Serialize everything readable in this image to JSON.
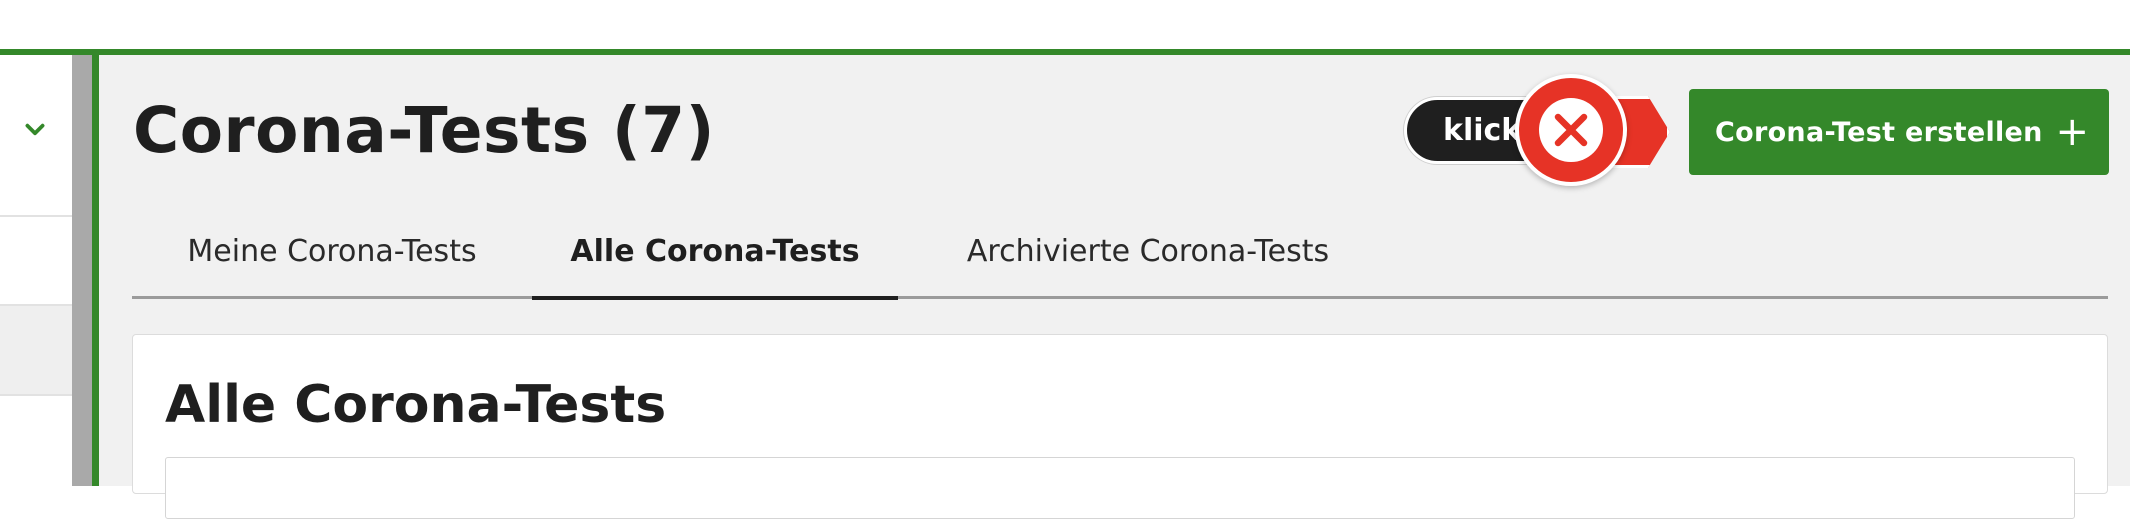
{
  "page": {
    "title": "Corona-Tests (7)"
  },
  "tutorial_hint": {
    "label": "klick",
    "close_icon": "close-x-icon",
    "color": "#e63326"
  },
  "actions": {
    "create_label": "Corona-Test erstellen",
    "create_icon": "plus-icon"
  },
  "tabs": [
    {
      "label": "Meine Corona-Tests",
      "active": false
    },
    {
      "label": "Alle Corona-Tests",
      "active": true
    },
    {
      "label": "Archivierte Corona-Tests",
      "active": false
    }
  ],
  "card": {
    "title": "Alle Corona-Tests"
  },
  "sidebar": {
    "toggle_icon": "chevron-down-icon"
  },
  "colors": {
    "brand_green": "#34882a",
    "text_dark": "#1f1f1f",
    "background": "#f1f1f1"
  }
}
